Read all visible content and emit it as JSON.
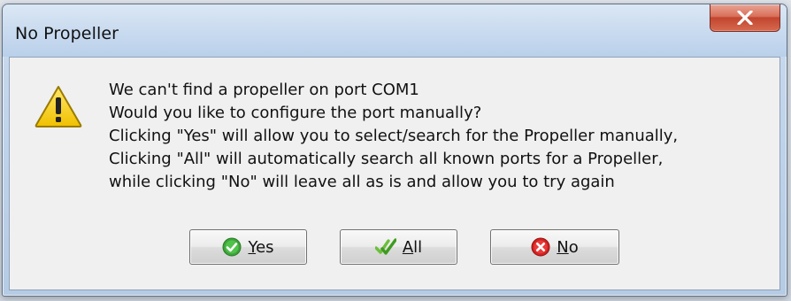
{
  "window": {
    "title": "No Propeller",
    "close_glyph": "X"
  },
  "dialog": {
    "icon": "warning-icon",
    "message_lines": [
      "We can't find a propeller on port COM1",
      "Would you like to configure the port manually?",
      "Clicking \"Yes\" will allow you to select/search for the Propeller manually,",
      "Clicking \"All\" will automatically search all known ports for a Propeller,",
      "while clicking \"No\" will leave all as is and allow you to try again"
    ]
  },
  "buttons": {
    "yes": {
      "mnemonic": "Y",
      "rest": "es",
      "icon": "green-check-circle-icon"
    },
    "all": {
      "mnemonic": "A",
      "rest": "ll",
      "icon": "green-double-check-icon"
    },
    "no": {
      "mnemonic": "N",
      "rest": "o",
      "icon": "red-x-circle-icon"
    }
  },
  "colors": {
    "title_bar": "#c8daef",
    "close_button": "#c2452f",
    "client_background": "#f0f0f0",
    "warning_yellow": "#f7d21a"
  }
}
